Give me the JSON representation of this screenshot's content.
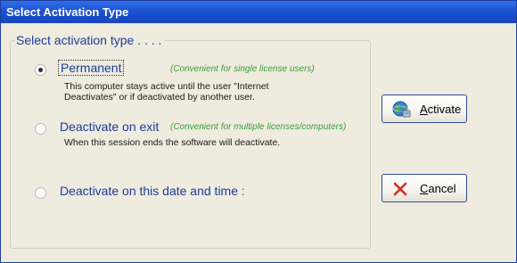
{
  "window": {
    "title": "Select Activation Type"
  },
  "group": {
    "title": "Select activation type . . . ."
  },
  "options": [
    {
      "label": "Permanent",
      "note": "(Convenient for single license users)",
      "desc_lines": [
        "This computer stays active until the user \"Internet",
        "Deactivates\" or if deactivated by another user."
      ],
      "selected": true
    },
    {
      "label": "Deactivate on exit",
      "note": "(Convenient for multiple licenses/computers)",
      "desc_lines": [
        "When this session ends the software will deactivate."
      ],
      "selected": false
    },
    {
      "label": "Deactivate on this date and time :",
      "selected": false
    }
  ],
  "buttons": {
    "activate": {
      "mnemonic": "A",
      "rest": "ctivate",
      "icon": "globe-network-icon"
    },
    "cancel": {
      "mnemonic": "C",
      "rest": "ancel",
      "icon": "red-x-icon"
    }
  },
  "colors": {
    "title_bar": "#1e56d6",
    "label_blue": "#1a3e9a",
    "note_green": "#3a9d3a",
    "cancel_red": "#d42a1f"
  }
}
